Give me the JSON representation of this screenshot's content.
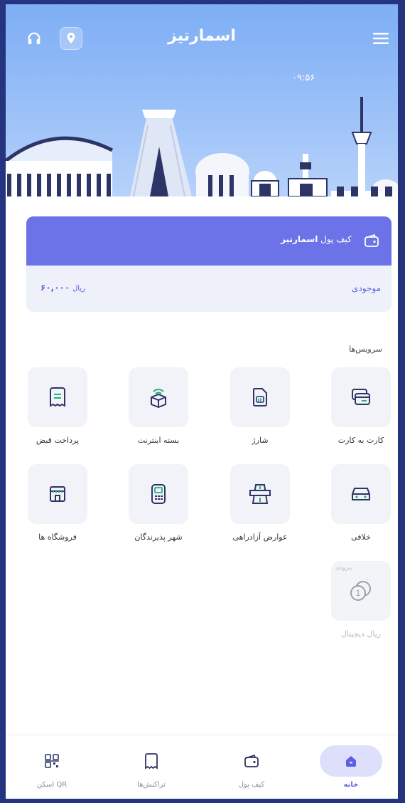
{
  "header": {
    "app_name": "اسمارتیز",
    "time": "۰۹:۵۶",
    "icons": [
      "menu-icon",
      "location-pin-icon",
      "headphones-icon"
    ]
  },
  "wallet": {
    "title_prefix": "کیف پول",
    "title_brand": "اسمارتیز",
    "balance_label": "موجودی",
    "balance_amount": "۶۰,۰۰۰",
    "balance_unit": "ریال"
  },
  "services": {
    "title": "سرویس‌ها",
    "items": [
      {
        "label": "کارت به کارت",
        "icon": "card-to-card-icon"
      },
      {
        "label": "شارژ",
        "icon": "sim-card-icon"
      },
      {
        "label": "بسته اینترنت",
        "icon": "internet-package-icon"
      },
      {
        "label": "پرداخت قبض",
        "icon": "bill-icon"
      },
      {
        "label": "خلافی",
        "icon": "car-icon"
      },
      {
        "label": "عوارض آزادراهی",
        "icon": "highway-icon"
      },
      {
        "label": "شهر پذیرندگان",
        "icon": "pos-terminal-icon"
      },
      {
        "label": "فروشگاه ها",
        "icon": "store-icon"
      },
      {
        "label": "ریال دیجیتال",
        "icon": "digital-rial-coin-icon",
        "badge": "به‌زودی"
      }
    ]
  },
  "nav": {
    "home": "خانه",
    "wallet": "کیف پول",
    "transactions": "تراکنش‌ها",
    "scan": "اسکن QR"
  },
  "colors": {
    "primary": "#6c72e8",
    "accent_text": "#5b61e0",
    "frame_bg": "#25347f",
    "sky": "#8fb8f6"
  }
}
